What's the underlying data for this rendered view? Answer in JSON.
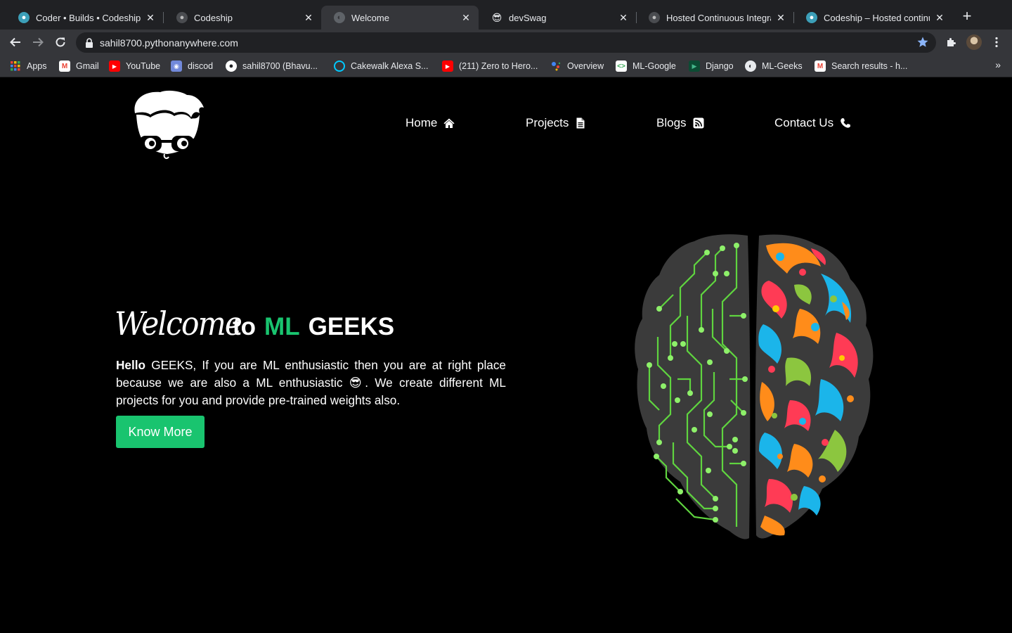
{
  "browser": {
    "tabs": [
      {
        "title": "Coder • Builds • Codeship",
        "icon": "codeship-icon",
        "active": false
      },
      {
        "title": "Codeship",
        "icon": "codeship-dark-icon",
        "active": false
      },
      {
        "title": "Welcome",
        "icon": "globe-icon",
        "active": true
      },
      {
        "title": "devSwag",
        "icon": "sunglasses-emoji-icon",
        "active": false
      },
      {
        "title": "Hosted Continuous Integrati",
        "icon": "codeship-dark-icon",
        "active": false
      },
      {
        "title": "Codeship – Hosted continuo",
        "icon": "codeship-icon",
        "active": false
      }
    ],
    "new_tab_label": "+",
    "url": "sahil8700.pythonanywhere.com",
    "bookmarks": [
      {
        "label": "Apps",
        "icon": "apps-grid-icon"
      },
      {
        "label": "Gmail",
        "icon": "gmail-icon"
      },
      {
        "label": "YouTube",
        "icon": "youtube-icon"
      },
      {
        "label": "discod",
        "icon": "discord-icon"
      },
      {
        "label": "sahil8700 (Bhavu...",
        "icon": "github-icon"
      },
      {
        "label": "Cakewalk Alexa S...",
        "icon": "alexa-icon"
      },
      {
        "label": "(211) Zero to Hero...",
        "icon": "youtube-icon"
      },
      {
        "label": "Overview",
        "icon": "google-assistant-icon"
      },
      {
        "label": "ML-Google",
        "icon": "code-icon"
      },
      {
        "label": "Django",
        "icon": "play-icon"
      },
      {
        "label": "ML-Geeks",
        "icon": "globe-icon"
      },
      {
        "label": "Search results - h...",
        "icon": "gmail-icon"
      }
    ],
    "bookmarks_more": "»"
  },
  "page": {
    "nav": [
      {
        "label": "Home",
        "icon": "home-icon"
      },
      {
        "label": "Projects",
        "icon": "file-icon"
      },
      {
        "label": "Blogs",
        "icon": "rss-icon"
      },
      {
        "label": "Contact Us",
        "icon": "phone-icon"
      }
    ],
    "hero": {
      "welcome": "Welcome",
      "to": "to",
      "ml": "ML",
      "geeks": "GEEKS",
      "text_bold": "Hello",
      "text_before_emoji": " GEEKS, If you are ML enthusiastic then you are at right place because we are also a ML enthusiastic ",
      "emoji": "😎",
      "text_after_emoji": ". We create different ML projects for you and provide pre-trained weights also.",
      "button": "Know More"
    },
    "colors": {
      "accent_green": "#19c46f",
      "background": "#000000"
    }
  }
}
